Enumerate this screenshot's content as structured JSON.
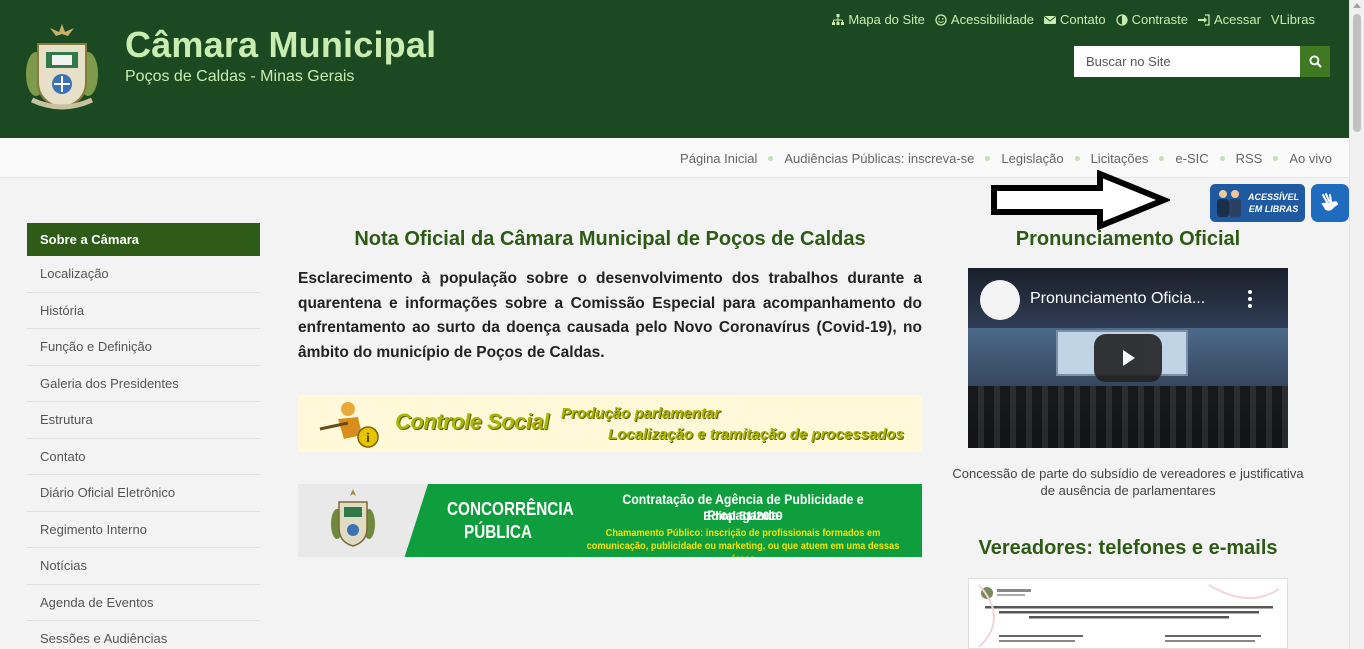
{
  "header": {
    "title": "Câmara Municipal",
    "subtitle": "Poços de Caldas - Minas Gerais",
    "top_links": [
      {
        "label": "Mapa do Site",
        "icon": "sitemap-icon"
      },
      {
        "label": "Acessibilidade",
        "icon": "smile-icon"
      },
      {
        "label": "Contato",
        "icon": "envelope-icon"
      },
      {
        "label": "Contraste",
        "icon": "contrast-icon"
      },
      {
        "label": "Acessar",
        "icon": "sign-in-icon"
      },
      {
        "label": "VLibras",
        "icon": ""
      }
    ],
    "search_placeholder": "Buscar no Site"
  },
  "nav": {
    "items": [
      "Página Inicial",
      "Audiências Públicas: inscreva-se",
      "Legislação",
      "Licitações",
      "e-SIC",
      "RSS",
      "Ao vivo"
    ]
  },
  "libras": {
    "badge_line1": "ACESSÍVEL",
    "badge_line2": "EM LIBRAS"
  },
  "sidebar": {
    "header": "Sobre a Câmara",
    "items": [
      "Localização",
      "História",
      "Função e Definição",
      "Galeria dos Presidentes",
      "Estrutura",
      "Contato",
      "Diário Oficial Eletrônico",
      "Regimento Interno",
      "Notícias",
      "Agenda de Eventos",
      "Sessões e Audiências"
    ]
  },
  "main": {
    "title": "Nota Oficial da Câmara Municipal de Poços de Caldas",
    "text": "Esclarecimento à população sobre o desenvolvimento dos trabalhos durante a quarentena e informações sobre a Comissão Especial para acompanhamento do enfrentamento ao surto da doença causada pelo Novo Coronavírus (Covid-19), no âmbito do município de Poços de Caldas.",
    "banner1": {
      "title": "Controle Social",
      "line1": "Produção parlamentar",
      "line2": "Localização e tramitação de processados"
    },
    "banner2": {
      "left_line1": "CONCORRÊNCIA",
      "left_line2": "PÚBLICA",
      "right_line1": "Contratação de Agência de Publicidade e Propaganda",
      "right_line2": "Edital 51/2019",
      "right_line3": "Chamamento Público: inscrição de profissionais formados em comunicação, publicidade ou marketing, ou que atuem em uma dessas áreas"
    }
  },
  "right": {
    "title": "Pronunciamento Oficial",
    "video_title": "Pronunciamento Oficia...",
    "caption": "Concessão de parte do subsídio de vereadores e justificativa de ausência de parlamentares",
    "title2": "Vereadores: telefones e e-mails"
  },
  "colors": {
    "header_bg": "#1b4a22",
    "title_green": "#c9ecb0",
    "accent": "#2e5b17",
    "search_btn": "#3f7a23"
  }
}
